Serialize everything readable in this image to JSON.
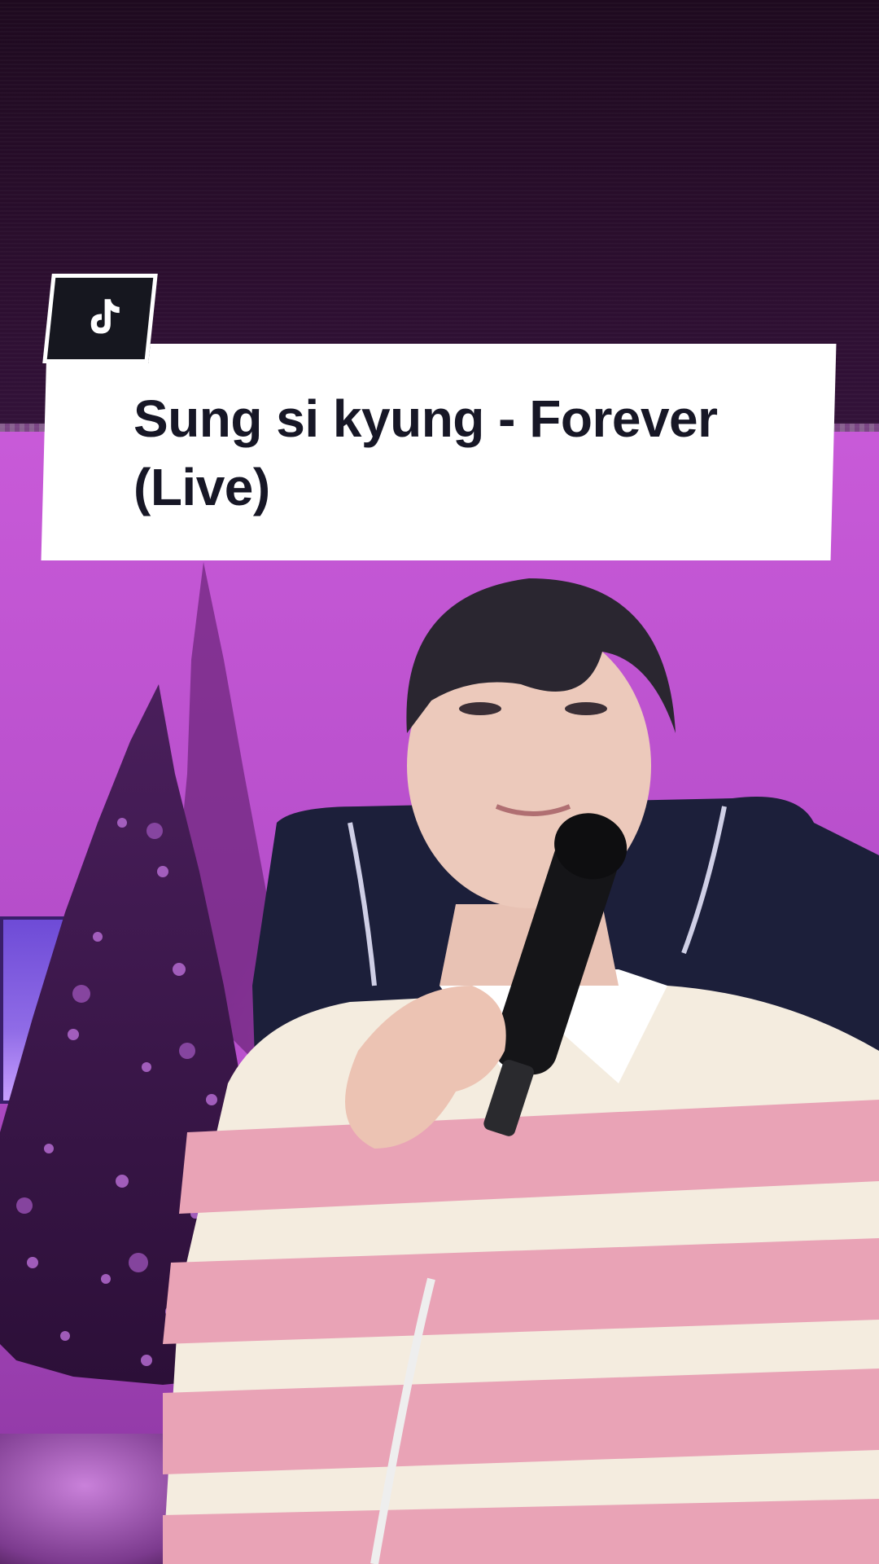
{
  "video": {
    "title": "Sung si kyung - Forever (Live)",
    "logo_icon": "tiktok-logo-icon"
  },
  "colors": {
    "card_background": "#ffffff",
    "title_text": "#171726",
    "badge_background": "#16171f",
    "wall_purple": "#c85ad8"
  }
}
